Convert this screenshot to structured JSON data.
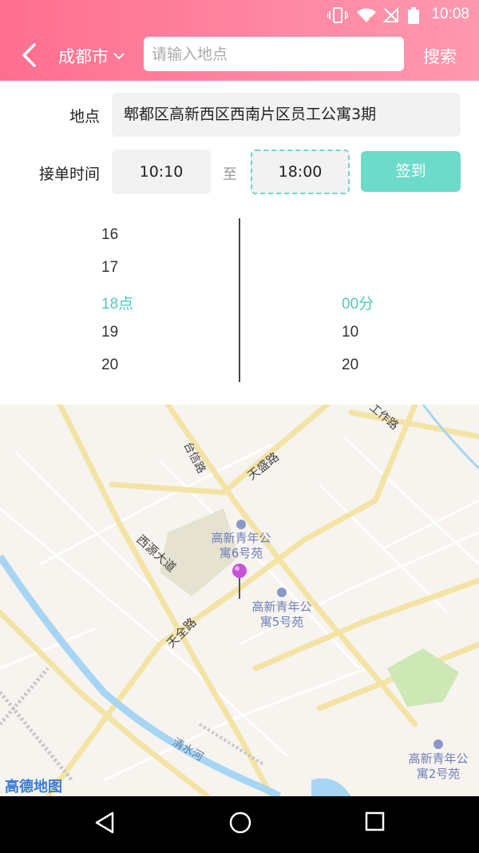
{
  "status_bar": {
    "time": "10:08"
  },
  "header": {
    "city": "成都市",
    "search_placeholder": "请输入地点",
    "search_button": "搜索"
  },
  "form": {
    "location_label": "地点",
    "location_value": "郫都区高新西区西南片区员工公寓3期",
    "time_label": "接单时间",
    "start_time": "10:10",
    "separator": "至",
    "end_time": "18:00",
    "signin_button": "签到"
  },
  "picker": {
    "hours": [
      "16",
      "17",
      "18点",
      "19",
      "20"
    ],
    "minutes": [
      "",
      "",
      "00分",
      "10",
      "20"
    ],
    "selected_index": 2
  },
  "map": {
    "roads": [
      "台信路",
      "天盛路",
      "西源大道",
      "天全路",
      "清水河",
      "工作路"
    ],
    "pois": [
      {
        "line1": "高新青年公",
        "line2": "寓6号苑"
      },
      {
        "line1": "高新青年公",
        "line2": "寓5号苑"
      },
      {
        "line1": "高新青年公",
        "line2": "寓2号苑"
      }
    ],
    "logo": "高德地图"
  },
  "colors": {
    "header_start": "#ff6e8f",
    "header_end": "#ff98b0",
    "accent": "#6cdbc9",
    "selected_text": "#4fcab8",
    "pin": "#c455d6"
  }
}
